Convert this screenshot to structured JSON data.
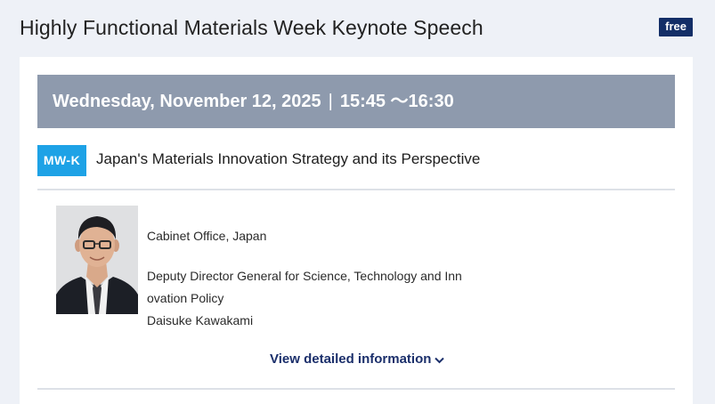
{
  "header": {
    "title": "Highly Functional Materials Week Keynote Speech",
    "badge": "free"
  },
  "session": {
    "date": "Wednesday, November 12, 2025",
    "separator": "|",
    "time": "15:45 〜16:30",
    "code": "MW-K",
    "title": "Japan's Materials Innovation Strategy and its Perspective"
  },
  "speaker": {
    "organization": "Cabinet Office, Japan",
    "position": "Deputy Director General for Science, Technology and Innovation Policy",
    "name": "Daisuke Kawakami"
  },
  "actions": {
    "detail_link": "View detailed information"
  },
  "colors": {
    "page_background": "#eef1f7",
    "badge_navy": "#132e67",
    "date_bar_gray": "#8e9aad",
    "session_code_blue": "#1ea2e6",
    "link_navy": "#1b2f6b"
  },
  "icons": {
    "detail_link_icon": "chevron-down-icon"
  }
}
